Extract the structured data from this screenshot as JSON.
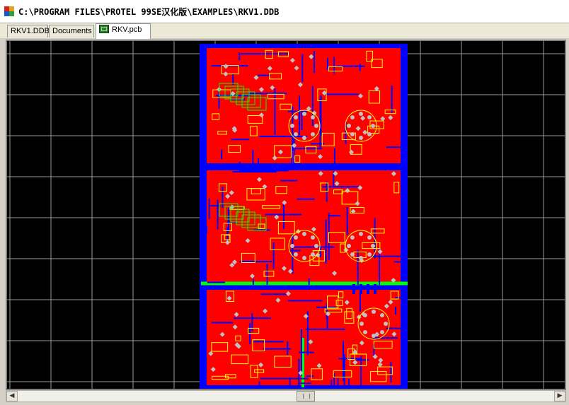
{
  "window": {
    "title": "C:\\PROGRAM FILES\\PROTEL 99SE汉化版\\EXAMPLES\\RKV1.DDB"
  },
  "tabs": [
    {
      "label": "RKV1.DDB",
      "active": false
    },
    {
      "label": "Documents",
      "active": false
    },
    {
      "label": "RKV.pcb",
      "active": true
    }
  ],
  "icons": {
    "app": "protel-app-icon",
    "pcb_tab": "pcb-document-icon",
    "scroll_left": "arrow-left-icon",
    "scroll_right": "arrow-right-icon"
  },
  "colors": {
    "board_background": "#000000",
    "grid": "#9a9a9a",
    "top_layer": "#ff0000",
    "bottom_layer": "#0000ff",
    "silkscreen": "#ffff00",
    "mechanical": "#00ff00",
    "pads": "#c0c0c0"
  }
}
